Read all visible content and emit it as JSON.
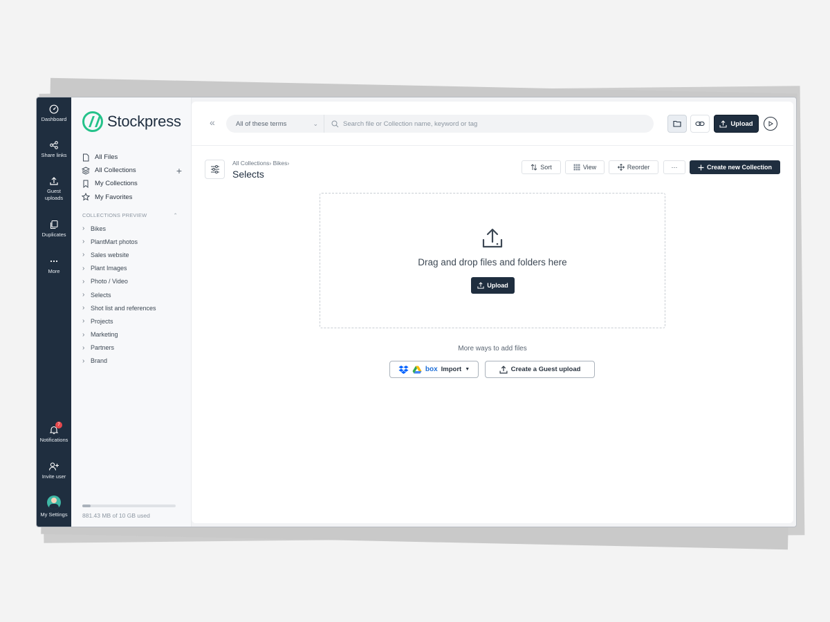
{
  "rail": {
    "items": [
      {
        "label": "Dashboard",
        "icon": "gauge-icon"
      },
      {
        "label": "Share links",
        "icon": "share-icon"
      },
      {
        "label": "Guest uploads",
        "icon": "upload-icon"
      },
      {
        "label": "Duplicates",
        "icon": "copy-icon"
      },
      {
        "label": "More",
        "icon": "dots-icon"
      }
    ],
    "bottom": {
      "notifications": "Notifications",
      "notifications_count": "7",
      "invite": "Invite user",
      "settings": "My Settings"
    }
  },
  "brand": {
    "name": "Stockpress",
    "accent": "#25c28a",
    "dark": "#1f2e3f"
  },
  "sidebar": {
    "nav": [
      {
        "label": "All Files",
        "icon": "file-icon"
      },
      {
        "label": "All Collections",
        "icon": "layers-icon"
      },
      {
        "label": "My Collections",
        "icon": "bookmark-icon"
      },
      {
        "label": "My Favorites",
        "icon": "star-icon"
      }
    ],
    "collections_heading": "COLLECTIONS PREVIEW",
    "collections": [
      "Bikes",
      "PlantMart photos",
      "Sales website",
      "Plant Images",
      "Photo / Video",
      "Selects",
      "Shot list and references",
      "Projects",
      "Marketing",
      "Partners",
      "Brand"
    ],
    "storage_text": "881.43 MB of 10 GB used",
    "storage_fraction": 0.086
  },
  "topbar": {
    "scope": "All of these terms",
    "search_placeholder": "Search file or Collection name, keyword or tag",
    "upload_label": "Upload"
  },
  "header": {
    "breadcrumb_1": "All Collections",
    "breadcrumb_2": "Bikes",
    "title": "Selects",
    "sort": "Sort",
    "view": "View",
    "reorder": "Reorder",
    "more": "···",
    "create": "Create new Collection"
  },
  "dropzone": {
    "text": "Drag and drop files and folders here",
    "upload_label": "Upload"
  },
  "more_ways": {
    "heading": "More ways to add files",
    "box": "box",
    "import": "Import",
    "guest": "Create a Guest upload"
  }
}
